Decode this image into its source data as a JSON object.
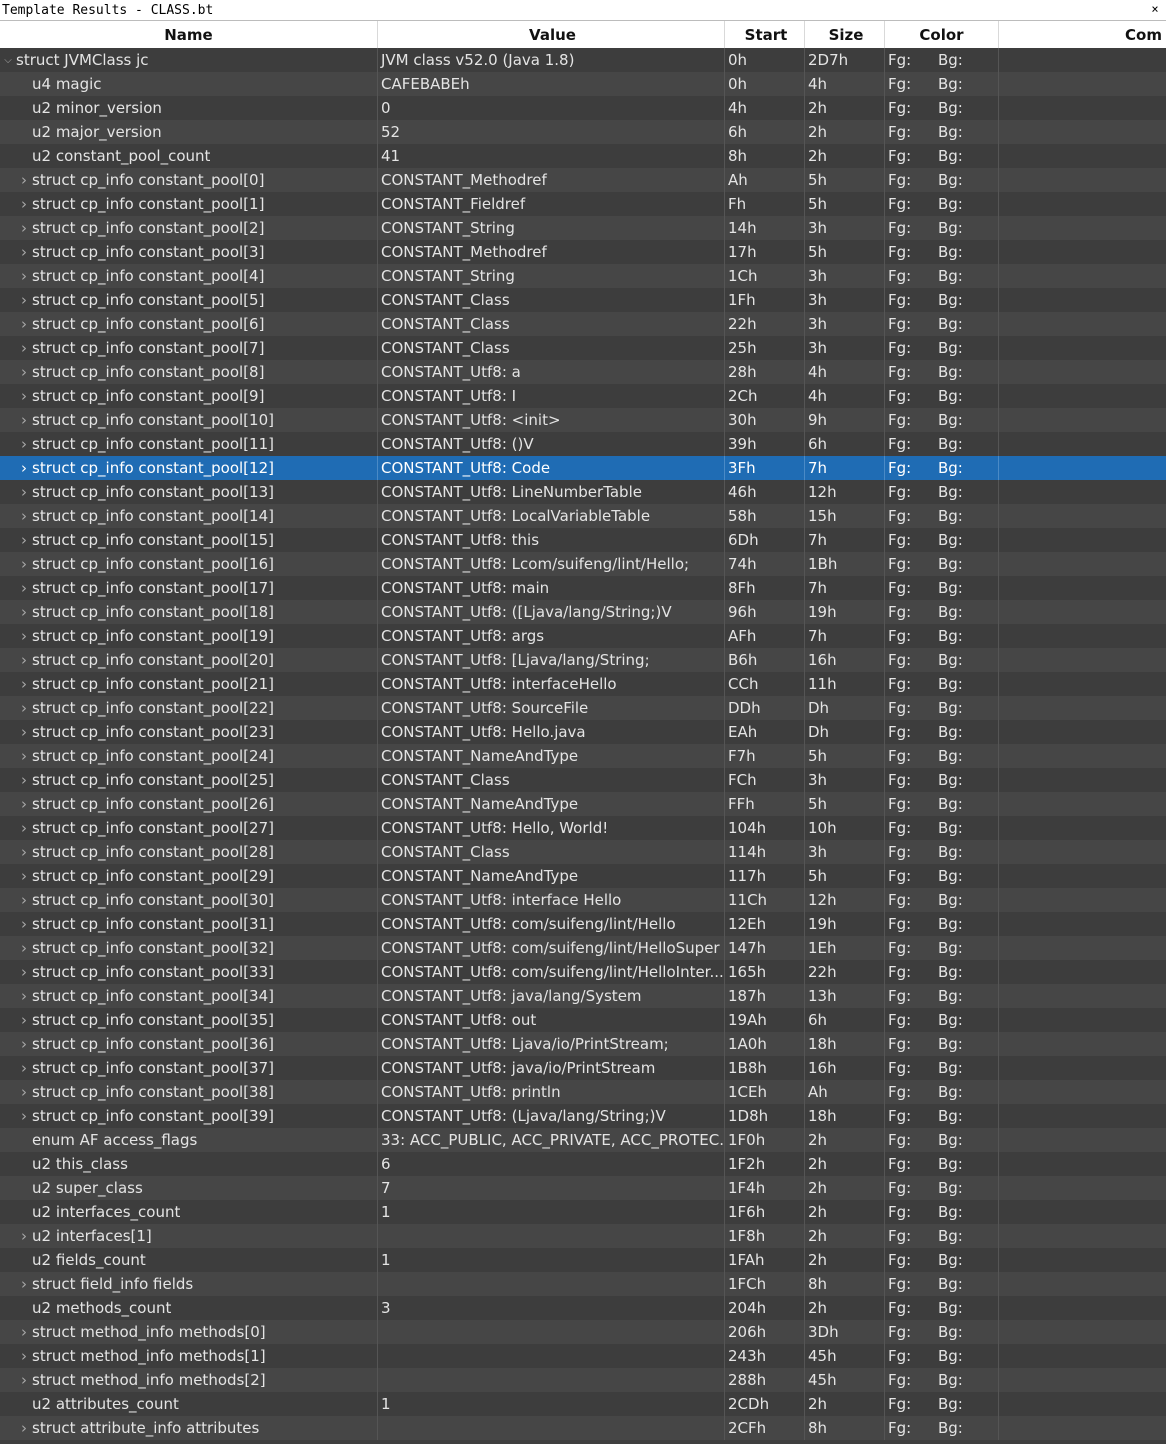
{
  "window": {
    "title": "Template Results - CLASS.bt",
    "close_glyph": "×"
  },
  "columns": {
    "name": "Name",
    "value": "Value",
    "start": "Start",
    "size": "Size",
    "color": "Color",
    "comment": "Com"
  },
  "colors": {
    "selection": "#1f6cb4",
    "row": "#3d3d3d",
    "row_alt": "#464646",
    "text": "#e4e4e4"
  },
  "rows": [
    {
      "name": "struct JVMClass jc",
      "value": "JVM class v52.0 (Java 1.8)",
      "start": "0h",
      "size": "2D7h",
      "fg": "Fg:",
      "bg": "Bg:",
      "level": 0,
      "expander": "open"
    },
    {
      "name": "u4 magic",
      "value": "CAFEBABEh",
      "start": "0h",
      "size": "4h",
      "fg": "Fg:",
      "bg": "Bg:",
      "level": 1,
      "expander": "none"
    },
    {
      "name": "u2 minor_version",
      "value": "0",
      "start": "4h",
      "size": "2h",
      "fg": "Fg:",
      "bg": "Bg:",
      "level": 1,
      "expander": "none"
    },
    {
      "name": "u2 major_version",
      "value": "52",
      "start": "6h",
      "size": "2h",
      "fg": "Fg:",
      "bg": "Bg:",
      "level": 1,
      "expander": "none"
    },
    {
      "name": "u2 constant_pool_count",
      "value": "41",
      "start": "8h",
      "size": "2h",
      "fg": "Fg:",
      "bg": "Bg:",
      "level": 1,
      "expander": "none"
    },
    {
      "name": "struct cp_info constant_pool[0]",
      "value": "CONSTANT_Methodref",
      "start": "Ah",
      "size": "5h",
      "fg": "Fg:",
      "bg": "Bg:",
      "level": 1,
      "expander": "closed"
    },
    {
      "name": "struct cp_info constant_pool[1]",
      "value": "CONSTANT_Fieldref",
      "start": "Fh",
      "size": "5h",
      "fg": "Fg:",
      "bg": "Bg:",
      "level": 1,
      "expander": "closed"
    },
    {
      "name": "struct cp_info constant_pool[2]",
      "value": "CONSTANT_String",
      "start": "14h",
      "size": "3h",
      "fg": "Fg:",
      "bg": "Bg:",
      "level": 1,
      "expander": "closed"
    },
    {
      "name": "struct cp_info constant_pool[3]",
      "value": "CONSTANT_Methodref",
      "start": "17h",
      "size": "5h",
      "fg": "Fg:",
      "bg": "Bg:",
      "level": 1,
      "expander": "closed"
    },
    {
      "name": "struct cp_info constant_pool[4]",
      "value": "CONSTANT_String",
      "start": "1Ch",
      "size": "3h",
      "fg": "Fg:",
      "bg": "Bg:",
      "level": 1,
      "expander": "closed"
    },
    {
      "name": "struct cp_info constant_pool[5]",
      "value": "CONSTANT_Class",
      "start": "1Fh",
      "size": "3h",
      "fg": "Fg:",
      "bg": "Bg:",
      "level": 1,
      "expander": "closed"
    },
    {
      "name": "struct cp_info constant_pool[6]",
      "value": "CONSTANT_Class",
      "start": "22h",
      "size": "3h",
      "fg": "Fg:",
      "bg": "Bg:",
      "level": 1,
      "expander": "closed"
    },
    {
      "name": "struct cp_info constant_pool[7]",
      "value": "CONSTANT_Class",
      "start": "25h",
      "size": "3h",
      "fg": "Fg:",
      "bg": "Bg:",
      "level": 1,
      "expander": "closed"
    },
    {
      "name": "struct cp_info constant_pool[8]",
      "value": "CONSTANT_Utf8: a",
      "start": "28h",
      "size": "4h",
      "fg": "Fg:",
      "bg": "Bg:",
      "level": 1,
      "expander": "closed"
    },
    {
      "name": "struct cp_info constant_pool[9]",
      "value": "CONSTANT_Utf8: I",
      "start": "2Ch",
      "size": "4h",
      "fg": "Fg:",
      "bg": "Bg:",
      "level": 1,
      "expander": "closed"
    },
    {
      "name": "struct cp_info constant_pool[10]",
      "value": "CONSTANT_Utf8: <init>",
      "start": "30h",
      "size": "9h",
      "fg": "Fg:",
      "bg": "Bg:",
      "level": 1,
      "expander": "closed"
    },
    {
      "name": "struct cp_info constant_pool[11]",
      "value": "CONSTANT_Utf8: ()V",
      "start": "39h",
      "size": "6h",
      "fg": "Fg:",
      "bg": "Bg:",
      "level": 1,
      "expander": "closed"
    },
    {
      "name": "struct cp_info constant_pool[12]",
      "value": "CONSTANT_Utf8: Code",
      "start": "3Fh",
      "size": "7h",
      "fg": "Fg:",
      "bg": "Bg:",
      "level": 1,
      "expander": "closed",
      "selected": true
    },
    {
      "name": "struct cp_info constant_pool[13]",
      "value": "CONSTANT_Utf8: LineNumberTable",
      "start": "46h",
      "size": "12h",
      "fg": "Fg:",
      "bg": "Bg:",
      "level": 1,
      "expander": "closed"
    },
    {
      "name": "struct cp_info constant_pool[14]",
      "value": "CONSTANT_Utf8: LocalVariableTable",
      "start": "58h",
      "size": "15h",
      "fg": "Fg:",
      "bg": "Bg:",
      "level": 1,
      "expander": "closed"
    },
    {
      "name": "struct cp_info constant_pool[15]",
      "value": "CONSTANT_Utf8: this",
      "start": "6Dh",
      "size": "7h",
      "fg": "Fg:",
      "bg": "Bg:",
      "level": 1,
      "expander": "closed"
    },
    {
      "name": "struct cp_info constant_pool[16]",
      "value": "CONSTANT_Utf8: Lcom/suifeng/lint/Hello;",
      "start": "74h",
      "size": "1Bh",
      "fg": "Fg:",
      "bg": "Bg:",
      "level": 1,
      "expander": "closed"
    },
    {
      "name": "struct cp_info constant_pool[17]",
      "value": "CONSTANT_Utf8: main",
      "start": "8Fh",
      "size": "7h",
      "fg": "Fg:",
      "bg": "Bg:",
      "level": 1,
      "expander": "closed"
    },
    {
      "name": "struct cp_info constant_pool[18]",
      "value": "CONSTANT_Utf8: ([Ljava/lang/String;)V",
      "start": "96h",
      "size": "19h",
      "fg": "Fg:",
      "bg": "Bg:",
      "level": 1,
      "expander": "closed"
    },
    {
      "name": "struct cp_info constant_pool[19]",
      "value": "CONSTANT_Utf8: args",
      "start": "AFh",
      "size": "7h",
      "fg": "Fg:",
      "bg": "Bg:",
      "level": 1,
      "expander": "closed"
    },
    {
      "name": "struct cp_info constant_pool[20]",
      "value": "CONSTANT_Utf8: [Ljava/lang/String;",
      "start": "B6h",
      "size": "16h",
      "fg": "Fg:",
      "bg": "Bg:",
      "level": 1,
      "expander": "closed"
    },
    {
      "name": "struct cp_info constant_pool[21]",
      "value": "CONSTANT_Utf8: interfaceHello",
      "start": "CCh",
      "size": "11h",
      "fg": "Fg:",
      "bg": "Bg:",
      "level": 1,
      "expander": "closed"
    },
    {
      "name": "struct cp_info constant_pool[22]",
      "value": "CONSTANT_Utf8: SourceFile",
      "start": "DDh",
      "size": "Dh",
      "fg": "Fg:",
      "bg": "Bg:",
      "level": 1,
      "expander": "closed"
    },
    {
      "name": "struct cp_info constant_pool[23]",
      "value": "CONSTANT_Utf8: Hello.java",
      "start": "EAh",
      "size": "Dh",
      "fg": "Fg:",
      "bg": "Bg:",
      "level": 1,
      "expander": "closed"
    },
    {
      "name": "struct cp_info constant_pool[24]",
      "value": "CONSTANT_NameAndType",
      "start": "F7h",
      "size": "5h",
      "fg": "Fg:",
      "bg": "Bg:",
      "level": 1,
      "expander": "closed"
    },
    {
      "name": "struct cp_info constant_pool[25]",
      "value": "CONSTANT_Class",
      "start": "FCh",
      "size": "3h",
      "fg": "Fg:",
      "bg": "Bg:",
      "level": 1,
      "expander": "closed"
    },
    {
      "name": "struct cp_info constant_pool[26]",
      "value": "CONSTANT_NameAndType",
      "start": "FFh",
      "size": "5h",
      "fg": "Fg:",
      "bg": "Bg:",
      "level": 1,
      "expander": "closed"
    },
    {
      "name": "struct cp_info constant_pool[27]",
      "value": "CONSTANT_Utf8: Hello, World!",
      "start": "104h",
      "size": "10h",
      "fg": "Fg:",
      "bg": "Bg:",
      "level": 1,
      "expander": "closed"
    },
    {
      "name": "struct cp_info constant_pool[28]",
      "value": "CONSTANT_Class",
      "start": "114h",
      "size": "3h",
      "fg": "Fg:",
      "bg": "Bg:",
      "level": 1,
      "expander": "closed"
    },
    {
      "name": "struct cp_info constant_pool[29]",
      "value": "CONSTANT_NameAndType",
      "start": "117h",
      "size": "5h",
      "fg": "Fg:",
      "bg": "Bg:",
      "level": 1,
      "expander": "closed"
    },
    {
      "name": "struct cp_info constant_pool[30]",
      "value": "CONSTANT_Utf8: interface Hello",
      "start": "11Ch",
      "size": "12h",
      "fg": "Fg:",
      "bg": "Bg:",
      "level": 1,
      "expander": "closed"
    },
    {
      "name": "struct cp_info constant_pool[31]",
      "value": "CONSTANT_Utf8: com/suifeng/lint/Hello",
      "start": "12Eh",
      "size": "19h",
      "fg": "Fg:",
      "bg": "Bg:",
      "level": 1,
      "expander": "closed"
    },
    {
      "name": "struct cp_info constant_pool[32]",
      "value": "CONSTANT_Utf8: com/suifeng/lint/HelloSuper",
      "start": "147h",
      "size": "1Eh",
      "fg": "Fg:",
      "bg": "Bg:",
      "level": 1,
      "expander": "closed"
    },
    {
      "name": "struct cp_info constant_pool[33]",
      "value": "CONSTANT_Utf8: com/suifeng/lint/HelloInter...",
      "start": "165h",
      "size": "22h",
      "fg": "Fg:",
      "bg": "Bg:",
      "level": 1,
      "expander": "closed"
    },
    {
      "name": "struct cp_info constant_pool[34]",
      "value": "CONSTANT_Utf8: java/lang/System",
      "start": "187h",
      "size": "13h",
      "fg": "Fg:",
      "bg": "Bg:",
      "level": 1,
      "expander": "closed"
    },
    {
      "name": "struct cp_info constant_pool[35]",
      "value": "CONSTANT_Utf8: out",
      "start": "19Ah",
      "size": "6h",
      "fg": "Fg:",
      "bg": "Bg:",
      "level": 1,
      "expander": "closed"
    },
    {
      "name": "struct cp_info constant_pool[36]",
      "value": "CONSTANT_Utf8: Ljava/io/PrintStream;",
      "start": "1A0h",
      "size": "18h",
      "fg": "Fg:",
      "bg": "Bg:",
      "level": 1,
      "expander": "closed"
    },
    {
      "name": "struct cp_info constant_pool[37]",
      "value": "CONSTANT_Utf8: java/io/PrintStream",
      "start": "1B8h",
      "size": "16h",
      "fg": "Fg:",
      "bg": "Bg:",
      "level": 1,
      "expander": "closed"
    },
    {
      "name": "struct cp_info constant_pool[38]",
      "value": "CONSTANT_Utf8: println",
      "start": "1CEh",
      "size": "Ah",
      "fg": "Fg:",
      "bg": "Bg:",
      "level": 1,
      "expander": "closed"
    },
    {
      "name": "struct cp_info constant_pool[39]",
      "value": "CONSTANT_Utf8: (Ljava/lang/String;)V",
      "start": "1D8h",
      "size": "18h",
      "fg": "Fg:",
      "bg": "Bg:",
      "level": 1,
      "expander": "closed"
    },
    {
      "name": "enum AF access_flags",
      "value": "33: ACC_PUBLIC, ACC_PRIVATE, ACC_PROTEC...",
      "start": "1F0h",
      "size": "2h",
      "fg": "Fg:",
      "bg": "Bg:",
      "level": 1,
      "expander": "none"
    },
    {
      "name": "u2 this_class",
      "value": "6",
      "start": "1F2h",
      "size": "2h",
      "fg": "Fg:",
      "bg": "Bg:",
      "level": 1,
      "expander": "none"
    },
    {
      "name": "u2 super_class",
      "value": "7",
      "start": "1F4h",
      "size": "2h",
      "fg": "Fg:",
      "bg": "Bg:",
      "level": 1,
      "expander": "none"
    },
    {
      "name": "u2 interfaces_count",
      "value": "1",
      "start": "1F6h",
      "size": "2h",
      "fg": "Fg:",
      "bg": "Bg:",
      "level": 1,
      "expander": "none"
    },
    {
      "name": "u2 interfaces[1]",
      "value": "",
      "start": "1F8h",
      "size": "2h",
      "fg": "Fg:",
      "bg": "Bg:",
      "level": 1,
      "expander": "closed"
    },
    {
      "name": "u2 fields_count",
      "value": "1",
      "start": "1FAh",
      "size": "2h",
      "fg": "Fg:",
      "bg": "Bg:",
      "level": 1,
      "expander": "none"
    },
    {
      "name": "struct field_info fields",
      "value": "",
      "start": "1FCh",
      "size": "8h",
      "fg": "Fg:",
      "bg": "Bg:",
      "level": 1,
      "expander": "closed"
    },
    {
      "name": "u2 methods_count",
      "value": "3",
      "start": "204h",
      "size": "2h",
      "fg": "Fg:",
      "bg": "Bg:",
      "level": 1,
      "expander": "none"
    },
    {
      "name": "struct method_info methods[0]",
      "value": "",
      "start": "206h",
      "size": "3Dh",
      "fg": "Fg:",
      "bg": "Bg:",
      "level": 1,
      "expander": "closed"
    },
    {
      "name": "struct method_info methods[1]",
      "value": "",
      "start": "243h",
      "size": "45h",
      "fg": "Fg:",
      "bg": "Bg:",
      "level": 1,
      "expander": "closed"
    },
    {
      "name": "struct method_info methods[2]",
      "value": "",
      "start": "288h",
      "size": "45h",
      "fg": "Fg:",
      "bg": "Bg:",
      "level": 1,
      "expander": "closed"
    },
    {
      "name": "u2 attributes_count",
      "value": "1",
      "start": "2CDh",
      "size": "2h",
      "fg": "Fg:",
      "bg": "Bg:",
      "level": 1,
      "expander": "none"
    },
    {
      "name": "struct attribute_info attributes",
      "value": "",
      "start": "2CFh",
      "size": "8h",
      "fg": "Fg:",
      "bg": "Bg:",
      "level": 1,
      "expander": "closed"
    }
  ]
}
